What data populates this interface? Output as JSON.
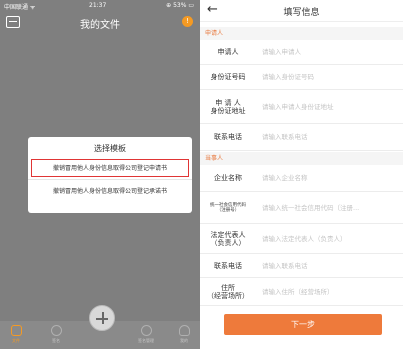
{
  "left_screen": {
    "status": {
      "carrier": "中国联通 ᯤ",
      "time": "21:37",
      "battery": "⊕ 53% ▭"
    },
    "header": {
      "title": "我的文件",
      "scan_icon": "scan-icon",
      "badge": "!"
    },
    "template_sheet": {
      "title": "选择模板",
      "options": [
        "撤销冒用他人身份信息取得公司登记申请书",
        "撤销冒用他人身份信息取得公司登记承诺书"
      ]
    },
    "tabbar": {
      "items": [
        {
          "label": "文件",
          "icon": "file-icon"
        },
        {
          "label": "签名",
          "icon": "sign-icon"
        },
        {
          "label": "",
          "icon": "plus-icon"
        },
        {
          "label": "签名管理",
          "icon": "manage-icon"
        },
        {
          "label": "我的",
          "icon": "user-icon"
        }
      ]
    }
  },
  "right_screen": {
    "header": {
      "back": "←",
      "title": "填写信息"
    },
    "sections": {
      "applicant": "申请人",
      "party": "当事人"
    },
    "fields": [
      {
        "label": "申请人",
        "placeholder": "请输入申请人"
      },
      {
        "label": "身份证号码",
        "placeholder": "请输入身份证号码"
      },
      {
        "label": "申 请 人\n身份证地址",
        "placeholder": "请输入申请人身份证地址"
      },
      {
        "label": "联系电话",
        "placeholder": "请输入联系电话"
      },
      {
        "label": "企业名称",
        "placeholder": "请输入企业名称"
      },
      {
        "label": "统一社会信用代码\n（注册号）",
        "placeholder": "请输入统一社会信用代码（注册..."
      },
      {
        "label": "法定代表人\n（负责人）",
        "placeholder": "请输入法定代表人（负责人）"
      },
      {
        "label": "联系电话",
        "placeholder": "请输入联系电话"
      },
      {
        "label": "住所\n（经营场所）",
        "placeholder": "请输入住所（经营场所）"
      }
    ],
    "next_button": "下一步"
  },
  "colors": {
    "accent": "#ee7a3b",
    "badge": "#f59a23",
    "selected_border": "#e03535"
  }
}
